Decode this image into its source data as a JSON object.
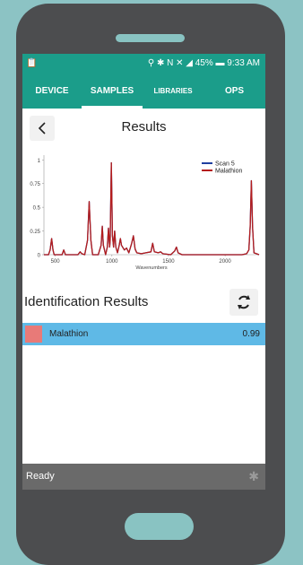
{
  "status_bar": {
    "right_text": "⚲ ✱ N ✕ ◢ 45% ▬ 9:33 AM",
    "left_icon": "📋"
  },
  "tabs": [
    {
      "label": "DEVICE",
      "active": false
    },
    {
      "label": "SAMPLES",
      "active": true
    },
    {
      "label": "LIBRARIES",
      "active": false
    },
    {
      "label": "OPS",
      "active": false
    }
  ],
  "header": {
    "title": "Results",
    "back_icon": "chevron-left-icon"
  },
  "chart_data": {
    "type": "line",
    "xlabel": "Wavenumbers",
    "ylabel": "",
    "x_ticks": [
      500,
      1000,
      1500,
      2000
    ],
    "y_ticks": [
      0,
      0.25,
      0.5,
      0.75,
      1
    ],
    "xlim": [
      400,
      2300
    ],
    "ylim": [
      0,
      1.05
    ],
    "legend_position": "top-right",
    "series": [
      {
        "name": "Scan 5",
        "color": "#1f3f9f",
        "points": [
          [
            400,
            0
          ],
          [
            440,
            0
          ],
          [
            455,
            0.05
          ],
          [
            468,
            0.17
          ],
          [
            480,
            0.05
          ],
          [
            490,
            0
          ],
          [
            560,
            0
          ],
          [
            575,
            0.05
          ],
          [
            590,
            0
          ],
          [
            700,
            0
          ],
          [
            720,
            0.03
          ],
          [
            735,
            0.01
          ],
          [
            760,
            0
          ],
          [
            785,
            0.15
          ],
          [
            800,
            0.56
          ],
          [
            815,
            0.15
          ],
          [
            830,
            0
          ],
          [
            880,
            0
          ],
          [
            905,
            0.1
          ],
          [
            915,
            0.3
          ],
          [
            925,
            0.1
          ],
          [
            945,
            0
          ],
          [
            960,
            0.08
          ],
          [
            970,
            0.28
          ],
          [
            980,
            0.08
          ],
          [
            985,
            0.15
          ],
          [
            995,
            0.97
          ],
          [
            1005,
            0.2
          ],
          [
            1015,
            0.08
          ],
          [
            1025,
            0.25
          ],
          [
            1035,
            0.08
          ],
          [
            1050,
            0.02
          ],
          [
            1065,
            0.1
          ],
          [
            1075,
            0.17
          ],
          [
            1085,
            0.1
          ],
          [
            1110,
            0.05
          ],
          [
            1130,
            0.07
          ],
          [
            1150,
            0.02
          ],
          [
            1175,
            0.12
          ],
          [
            1190,
            0.2
          ],
          [
            1205,
            0.06
          ],
          [
            1220,
            0.02
          ],
          [
            1260,
            0.01
          ],
          [
            1300,
            0.02
          ],
          [
            1345,
            0.03
          ],
          [
            1360,
            0.12
          ],
          [
            1375,
            0.03
          ],
          [
            1410,
            0.02
          ],
          [
            1430,
            0.03
          ],
          [
            1450,
            0.01
          ],
          [
            1520,
            0
          ],
          [
            1555,
            0.04
          ],
          [
            1570,
            0.08
          ],
          [
            1585,
            0.02
          ],
          [
            1620,
            0
          ],
          [
            2150,
            0
          ],
          [
            2190,
            0.01
          ],
          [
            2210,
            0.05
          ],
          [
            2222,
            0.3
          ],
          [
            2232,
            0.78
          ],
          [
            2242,
            0.3
          ],
          [
            2255,
            0.02
          ],
          [
            2300,
            0
          ]
        ]
      },
      {
        "name": "Malathion",
        "color": "#b51c1c",
        "points": [
          [
            400,
            0
          ],
          [
            440,
            0
          ],
          [
            455,
            0.05
          ],
          [
            468,
            0.17
          ],
          [
            480,
            0.05
          ],
          [
            490,
            0
          ],
          [
            560,
            0
          ],
          [
            575,
            0.05
          ],
          [
            590,
            0
          ],
          [
            700,
            0
          ],
          [
            720,
            0.03
          ],
          [
            735,
            0.01
          ],
          [
            760,
            0
          ],
          [
            785,
            0.15
          ],
          [
            800,
            0.56
          ],
          [
            815,
            0.15
          ],
          [
            830,
            0
          ],
          [
            880,
            0
          ],
          [
            905,
            0.1
          ],
          [
            915,
            0.3
          ],
          [
            925,
            0.1
          ],
          [
            945,
            0
          ],
          [
            960,
            0.08
          ],
          [
            970,
            0.28
          ],
          [
            980,
            0.08
          ],
          [
            985,
            0.15
          ],
          [
            995,
            0.97
          ],
          [
            1005,
            0.2
          ],
          [
            1015,
            0.08
          ],
          [
            1025,
            0.25
          ],
          [
            1035,
            0.08
          ],
          [
            1050,
            0.02
          ],
          [
            1065,
            0.1
          ],
          [
            1075,
            0.17
          ],
          [
            1085,
            0.1
          ],
          [
            1110,
            0.05
          ],
          [
            1130,
            0.07
          ],
          [
            1150,
            0.02
          ],
          [
            1175,
            0.12
          ],
          [
            1190,
            0.2
          ],
          [
            1205,
            0.06
          ],
          [
            1220,
            0.02
          ],
          [
            1260,
            0.01
          ],
          [
            1300,
            0.02
          ],
          [
            1345,
            0.03
          ],
          [
            1360,
            0.12
          ],
          [
            1375,
            0.03
          ],
          [
            1410,
            0.02
          ],
          [
            1430,
            0.03
          ],
          [
            1450,
            0.01
          ],
          [
            1520,
            0
          ],
          [
            1555,
            0.04
          ],
          [
            1570,
            0.08
          ],
          [
            1585,
            0.02
          ],
          [
            1620,
            0
          ],
          [
            2150,
            0
          ],
          [
            2190,
            0.01
          ],
          [
            2210,
            0.05
          ],
          [
            2222,
            0.3
          ],
          [
            2232,
            0.78
          ],
          [
            2242,
            0.3
          ],
          [
            2255,
            0.02
          ],
          [
            2300,
            0
          ]
        ]
      }
    ]
  },
  "identification": {
    "title": "Identification Results",
    "refresh_icon": "refresh-icon",
    "results": [
      {
        "name": "Malathion",
        "score": "0.99",
        "color": "#e87a78"
      }
    ]
  },
  "bottom_status": {
    "text": "Ready",
    "icon": "bluetooth-icon"
  }
}
